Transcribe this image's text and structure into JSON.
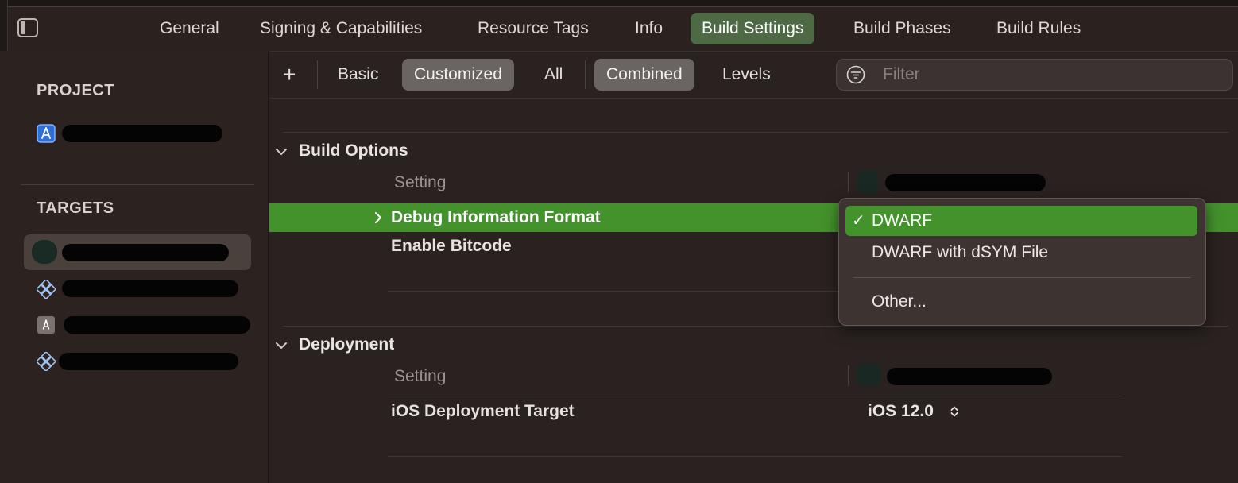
{
  "tabs": [
    "General",
    "Signing & Capabilities",
    "Resource Tags",
    "Info",
    "Build Settings",
    "Build Phases",
    "Build Rules"
  ],
  "active_tab": "Build Settings",
  "sidebar": {
    "project_label": "PROJECT",
    "targets_label": "TARGETS"
  },
  "toolbar": {
    "add_label": "+",
    "basic": "Basic",
    "customized": "Customized",
    "all": "All",
    "combined": "Combined",
    "levels": "Levels",
    "filter_placeholder": "Filter"
  },
  "groups": {
    "build_options": {
      "title": "Build Options",
      "column_header": "Setting",
      "rows": [
        {
          "name": "Debug Information Format"
        },
        {
          "name": "Enable Bitcode"
        }
      ]
    },
    "deployment": {
      "title": "Deployment",
      "column_header": "Setting",
      "rows": [
        {
          "name": "iOS Deployment Target",
          "value": "iOS 12.0"
        }
      ]
    }
  },
  "popup": {
    "items": [
      "DWARF",
      "DWARF with dSYM File",
      "Other..."
    ],
    "selected": "DWARF",
    "check": "✓"
  },
  "colors": {
    "accent_green": "#43922c",
    "active_tab": "#4d6a45",
    "background": "#2a2220"
  }
}
